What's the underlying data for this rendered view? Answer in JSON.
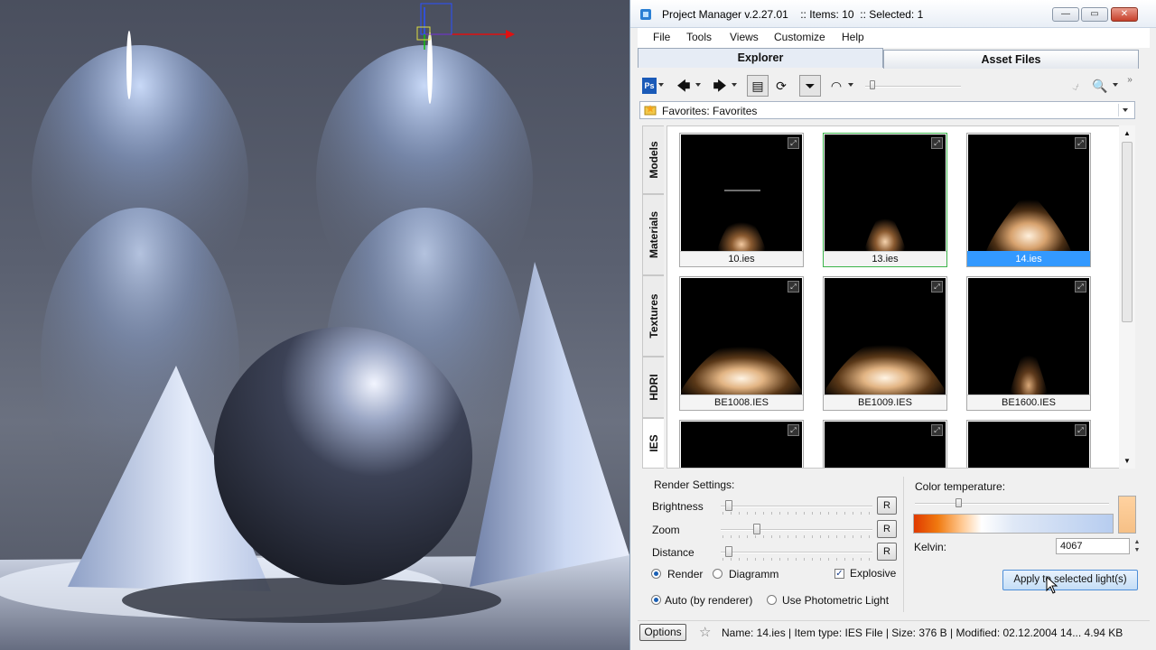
{
  "window": {
    "title": "Project Manager v.2.27.01",
    "items_info": ":: Items: 10",
    "selected_info": ":: Selected: 1"
  },
  "menu": [
    "File",
    "Tools",
    "Views",
    "Customize",
    "Help"
  ],
  "tabs": [
    {
      "label": "Explorer",
      "active": true
    },
    {
      "label": "Asset Files",
      "active": false
    }
  ],
  "favorites": {
    "path": "Favorites: Favorites"
  },
  "side_tabs": [
    "Models",
    "Materials",
    "Textures",
    "HDRI",
    "IES"
  ],
  "thumbnails": [
    {
      "name": "10.ies",
      "state": "normal"
    },
    {
      "name": "13.ies",
      "state": "current"
    },
    {
      "name": "14.ies",
      "state": "selected"
    },
    {
      "name": "BE1008.IES",
      "state": "normal"
    },
    {
      "name": "BE1009.IES",
      "state": "normal"
    },
    {
      "name": "BE1600.IES",
      "state": "normal"
    },
    {
      "name": "",
      "state": "normal"
    },
    {
      "name": "",
      "state": "normal"
    },
    {
      "name": "",
      "state": "normal"
    }
  ],
  "render_settings": {
    "title": "Render Settings:",
    "brightness_label": "Brightness",
    "zoom_label": "Zoom",
    "distance_label": "Distance",
    "reset_label": "R",
    "render_label": "Render",
    "diagram_label": "Diagramm",
    "explosive_label": "Explosive",
    "auto_label": "Auto (by renderer)",
    "photometric_label": "Use Photometric Light",
    "mode": "Render",
    "explosive_checked": true,
    "light_mode": "Auto (by renderer)"
  },
  "color_temperature": {
    "title": "Color temperature:",
    "kelvin_label": "Kelvin:",
    "kelvin_value": "4067",
    "apply_label": "Apply to selected light(s)"
  },
  "status": {
    "options_label": "Options",
    "text": "Name: 14.ies | Item type: IES File | Size: 376 B | Modified: 02.12.2004 14...  4.94 KB"
  }
}
